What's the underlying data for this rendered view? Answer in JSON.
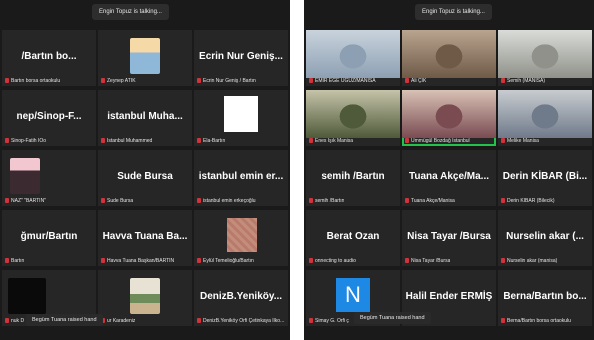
{
  "left_panel": {
    "banner": "Engin Topuz is talking...",
    "raised_hand_toast": "Begüm Tuana raised hand",
    "tiles": [
      {
        "name": "",
        "label": "/Bartın bo...",
        "caption": "Bartın borsa ortaokulu",
        "kind": "name"
      },
      {
        "name": "",
        "label": "",
        "caption": "Zeynep ATİK",
        "kind": "cartoon"
      },
      {
        "name": "",
        "label": "Ecrin Nur Geniş...",
        "caption": "Ecrin Nur Geniş / Bartın",
        "kind": "name"
      },
      {
        "name": "",
        "label": "nep/Sinop-F...",
        "caption": "Sinop-Fatih İÖo",
        "kind": "name"
      },
      {
        "name": "",
        "label": "istanbul Muha...",
        "caption": "İstanbul Muhammed",
        "kind": "name"
      },
      {
        "name": "",
        "label": "",
        "caption": "Ela-Bartın",
        "kind": "white"
      },
      {
        "name": "",
        "label": "",
        "caption": "NAZ\" \"BARTIN\"",
        "kind": "anime"
      },
      {
        "name": "",
        "label": "Sude Bursa",
        "caption": "Sude Bursa",
        "kind": "name"
      },
      {
        "name": "",
        "label": "istanbul emin er...",
        "caption": "istanbul emin erkeçoğlu",
        "kind": "name"
      },
      {
        "name": "",
        "label": "ğmur/Bartın",
        "caption": "Bartın",
        "kind": "name"
      },
      {
        "name": "",
        "label": "Havva Tuana Ba...",
        "caption": "Havva Tuana Başkan/BARTIN",
        "kind": "name"
      },
      {
        "name": "",
        "label": "",
        "caption": "Eylül Temelioğlu/Bartın",
        "kind": "blur"
      },
      {
        "name": "",
        "label": "",
        "caption": "nuk D",
        "kind": "dark"
      },
      {
        "name": "",
        "label": "",
        "caption": "ur Karadeniz",
        "kind": "cartoon2"
      },
      {
        "name": "",
        "label": "DenizB.Yeniköy...",
        "caption": "DenizB.Yeniköy Örfi Çetinkaya İlko...",
        "kind": "name"
      }
    ]
  },
  "right_panel": {
    "banner": "Engin Topuz is talking...",
    "raised_hand_toast": "Begüm Tuana raised hand",
    "tiles": [
      {
        "label": "",
        "caption": "EMİR EGE UĞUZ/MANİSA",
        "kind": "photo",
        "c1": "#c9d3dc",
        "c2": "#8da0b3"
      },
      {
        "label": "",
        "caption": "Ali ÇİK",
        "kind": "photo",
        "c1": "#b9a48f",
        "c2": "#6f5a48"
      },
      {
        "label": "",
        "caption": "Semih (MANİSA)",
        "kind": "photo",
        "c1": "#d9dcd8",
        "c2": "#90918a"
      },
      {
        "label": "",
        "caption": "Enes Işık Manisa",
        "kind": "photo",
        "c1": "#c5c3a9",
        "c2": "#4f5a3a"
      },
      {
        "label": "",
        "caption": "Ümmügül Bozdağ İstanbul",
        "kind": "photo",
        "c1": "#d8c1b5",
        "c2": "#7a4c52",
        "highlight": true
      },
      {
        "label": "",
        "caption": "Melike Manisa",
        "kind": "photo",
        "c1": "#c8ccd0",
        "c2": "#6f7a8a"
      },
      {
        "label": "semih /Bartın",
        "caption": "semih /Bartın",
        "kind": "name"
      },
      {
        "label": "Tuana Akçe/Ma...",
        "caption": "Tuana Akçe/Manisa",
        "kind": "name"
      },
      {
        "label": "Derin KİBAR (Bi...",
        "caption": "Derin KİBAR (Bilecik)",
        "kind": "name"
      },
      {
        "label": "Berat Ozan",
        "caption": "onnecting to audio",
        "kind": "name"
      },
      {
        "label": "Nisa Tayar /Bursa",
        "caption": "Nisa Tayar /Bursa",
        "kind": "name"
      },
      {
        "label": "Nurselin akar (...",
        "caption": "Nurselin akar (manisa)",
        "kind": "name"
      },
      {
        "label": "",
        "caption": "Simay G. Örfi ç",
        "kind": "navatar",
        "avatar": "N"
      },
      {
        "label": "Halil Ender ERMİŞ",
        "caption": "ERMİŞ",
        "kind": "name"
      },
      {
        "label": "Berna/Bartın bo...",
        "caption": "Berna/Bartın borsa ortaokulu",
        "kind": "name"
      }
    ]
  }
}
